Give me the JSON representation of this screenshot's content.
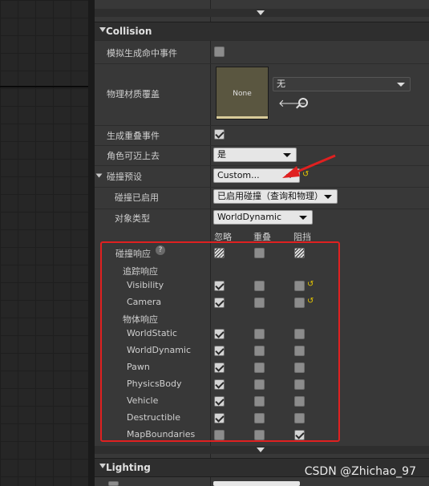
{
  "collision": {
    "header": "Collision",
    "sim_hit_label": "模拟生成命中事件",
    "phys_mat_label": "物理材质覆盖",
    "phys_mat_thumb": "None",
    "phys_mat_value": "无",
    "gen_overlap_label": "生成重叠事件",
    "can_step_label": "角色可迈上去",
    "can_step_value": "是",
    "preset_label": "碰撞预设",
    "preset_value": "Custom...",
    "enabled_label": "碰撞已启用",
    "enabled_value": "已启用碰撞（查询和物理）",
    "objtype_label": "对象类型",
    "objtype_value": "WorldDynamic",
    "col_ignore": "忽略",
    "col_overlap": "重叠",
    "col_block": "阻挡",
    "responses_label": "碰撞响应",
    "trace_label": "追踪响应",
    "object_label": "物体响应",
    "rows": [
      {
        "name": "Visibility",
        "ignore": true,
        "overlap": false,
        "block": false
      },
      {
        "name": "Camera",
        "ignore": true,
        "overlap": false,
        "block": false
      },
      {
        "name": "WorldStatic",
        "ignore": true,
        "overlap": false,
        "block": false
      },
      {
        "name": "WorldDynamic",
        "ignore": true,
        "overlap": false,
        "block": false
      },
      {
        "name": "Pawn",
        "ignore": true,
        "overlap": false,
        "block": false
      },
      {
        "name": "PhysicsBody",
        "ignore": true,
        "overlap": false,
        "block": false
      },
      {
        "name": "Vehicle",
        "ignore": true,
        "overlap": false,
        "block": false
      },
      {
        "name": "Destructible",
        "ignore": true,
        "overlap": false,
        "block": false
      },
      {
        "name": "MapBoundaries",
        "ignore": false,
        "overlap": false,
        "block": true
      }
    ]
  },
  "lighting": {
    "header": "Lighting"
  },
  "watermark": "CSDN @Zhichao_97",
  "colors": {
    "annotation_red": "#e02020",
    "panel_bg": "#383838",
    "reset_yellow": "#e8c800"
  }
}
